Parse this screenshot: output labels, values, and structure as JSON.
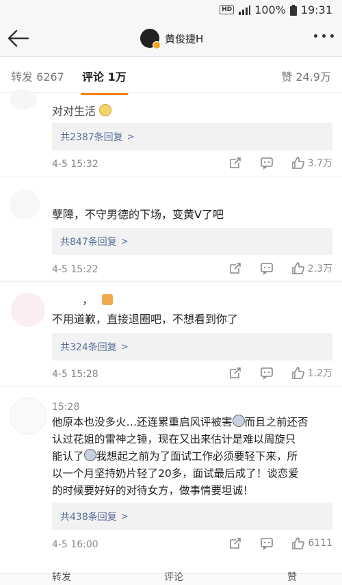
{
  "status_bar": {
    "hd": "HD",
    "battery": "100%",
    "time": "19:31"
  },
  "header": {
    "username": "黄俊捷H"
  },
  "tabs": [
    {
      "label": "转发",
      "count": "6267"
    },
    {
      "label": "评论",
      "count": "1万"
    },
    {
      "label": "赞",
      "count": "24.9万"
    }
  ],
  "comments": [
    {
      "text_partial": "对对生活",
      "reply_label": "共2387条回复",
      "time": "4-5 15:32",
      "likes": "3.7万"
    },
    {
      "text": "孽障，不守男德的下场，变黄V了吧",
      "reply_label": "共847条回复",
      "time": "4-5 15:22",
      "likes": "2.3万"
    },
    {
      "name_suffix": "，",
      "text": "不用道歉，直接退圈吧，不想看到你了",
      "reply_label": "共324条回复",
      "time": "4-5 15:28",
      "likes": "1.2万"
    },
    {
      "inline_time": "15:28",
      "line1a": "他原本也没多火…还连累重启风评被害",
      "line1b": "而且之前还否",
      "line2": "认过花姐的雷神之锤，现在又出来估计是难以周旋只",
      "line3a": "能认了",
      "line3b": "我想起之前为了面试工作必须要轻下来，所",
      "line4": "以一个月坚持奶片轻了20多，面试最后成了！谈恋爱",
      "line5": "的时候要好好的对待女方，做事情要坦诚！",
      "reply_label": "共438条回复",
      "time": "4-5 16:00",
      "likes": "6111"
    }
  ],
  "bottom_bar": {
    "repost": "转发",
    "comment": "评论",
    "like": "赞"
  },
  "colors": {
    "accent": "#ff8200",
    "link": "#566f99",
    "meta": "#888888",
    "reply_bg": "#f2f2f2"
  }
}
